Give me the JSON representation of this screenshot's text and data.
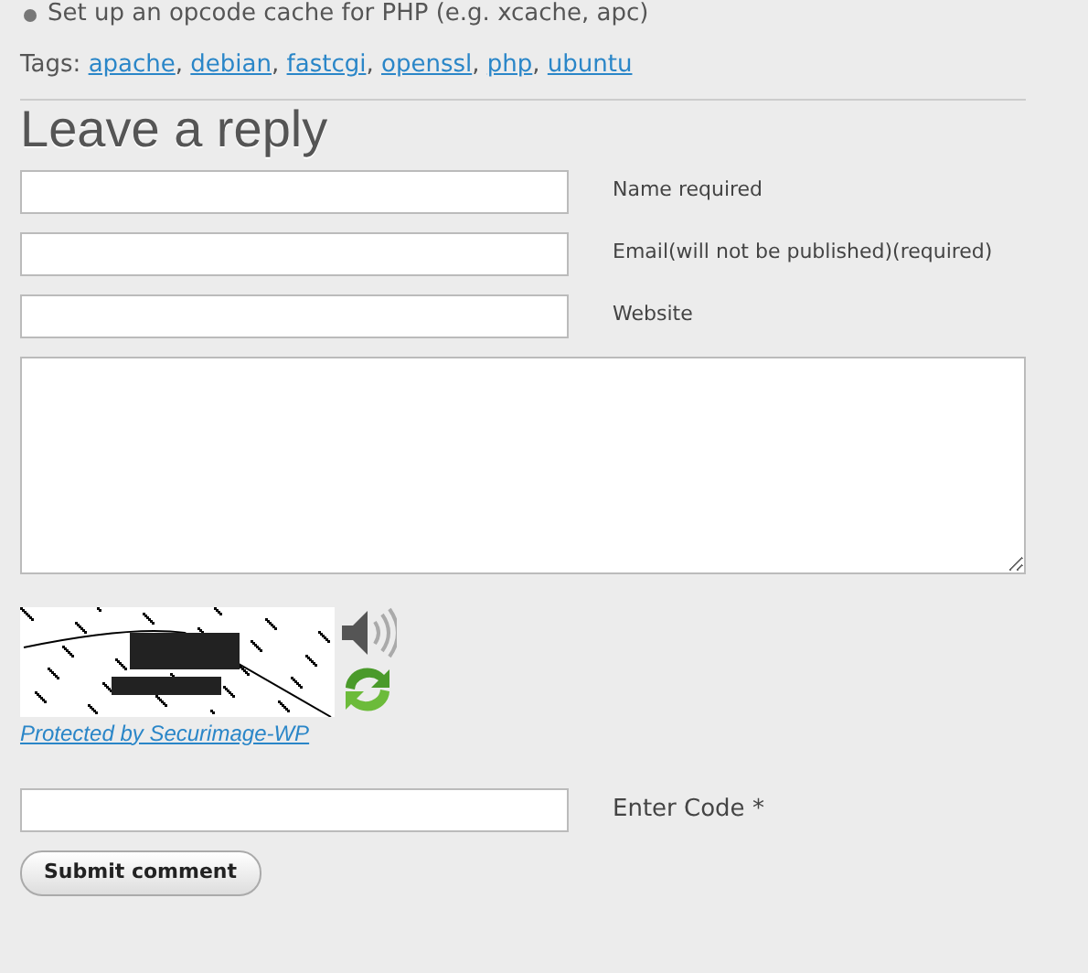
{
  "bullet_item": "Set up an opcode cache for PHP (e.g. xcache, apc)",
  "tags": {
    "label": "Tags:",
    "separator": ",",
    "links": [
      "apache",
      "debian",
      "fastcgi",
      "openssl",
      "php",
      "ubuntu"
    ]
  },
  "reply": {
    "title": "Leave a reply",
    "fields": [
      {
        "label": "Name required"
      },
      {
        "label": "Email(will not be published)(required)"
      },
      {
        "label": "Website"
      }
    ],
    "captcha": {
      "link": "Protected by Securimage-WP",
      "code_label": "Enter Code *"
    },
    "submit": "Submit comment"
  }
}
